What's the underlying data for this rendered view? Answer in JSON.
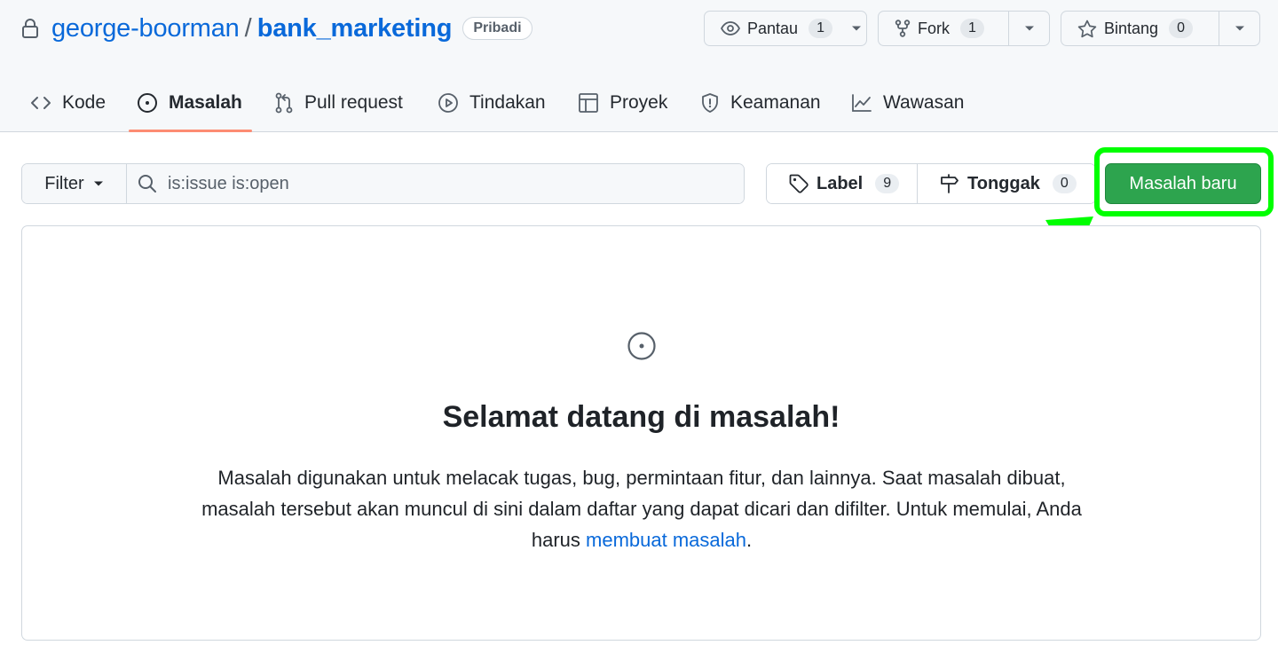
{
  "repo": {
    "owner": "george-boorman",
    "separator": "/",
    "name": "bank_marketing",
    "visibility": "Pribadi"
  },
  "repo_actions": {
    "watch": {
      "label": "Pantau",
      "count": "1"
    },
    "fork": {
      "label": "Fork",
      "count": "1"
    },
    "star": {
      "label": "Bintang",
      "count": "0"
    }
  },
  "tabs": [
    {
      "label": "Kode",
      "icon": "code-icon"
    },
    {
      "label": "Masalah",
      "icon": "issue-opened-icon",
      "active": true
    },
    {
      "label": "Pull request",
      "icon": "pull-request-icon"
    },
    {
      "label": "Tindakan",
      "icon": "play-icon"
    },
    {
      "label": "Proyek",
      "icon": "table-icon"
    },
    {
      "label": "Keamanan",
      "icon": "shield-icon"
    },
    {
      "label": "Wawasan",
      "icon": "graph-icon"
    }
  ],
  "toolbar": {
    "filter_label": "Filter",
    "search_value": "is:issue is:open",
    "label_button": "Label",
    "label_count": "9",
    "milestone_button": "Tonggak",
    "milestone_count": "0",
    "new_issue_button": "Masalah baru"
  },
  "blankslate": {
    "title": "Selamat datang di masalah!",
    "text_before": "Masalah digunakan untuk melacak tugas, bug, permintaan fitur, dan lainnya. Saat masalah dibuat, masalah tersebut akan muncul di sini dalam daftar yang dapat dicari dan difilter. Untuk memulai, Anda harus ",
    "link_text": "membuat masalah",
    "text_after": "."
  },
  "colors": {
    "link": "#0969da",
    "primary_button": "#2da44e",
    "annotation": "#00ff00",
    "tab_underline": "#fd8c73"
  }
}
